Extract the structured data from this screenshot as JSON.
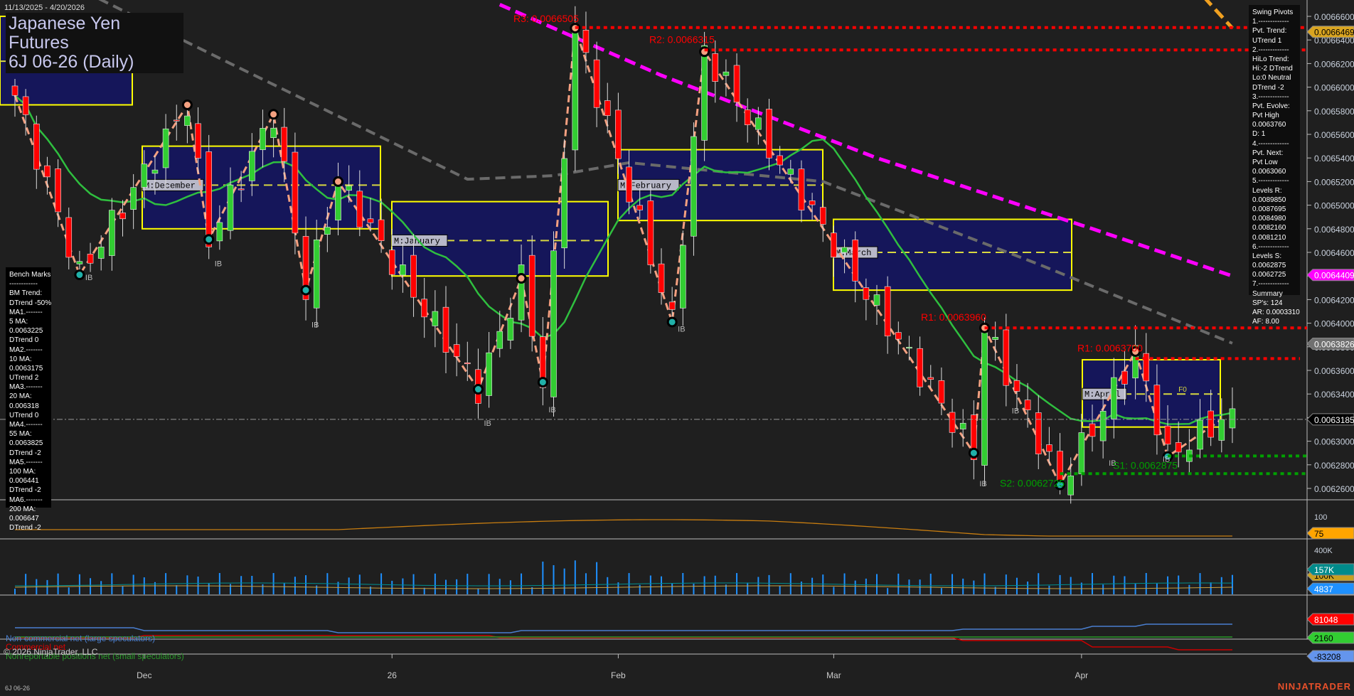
{
  "header": {
    "date_range": "11/13/2025 - 4/20/2026",
    "title_line1": "Japanese Yen Futures",
    "title_line2": "6J 06-26 (Daily)"
  },
  "swing_pivots": [
    "Swing Pivots",
    "1.-------------",
    "Pvt. Trend:",
    "UTrend 1",
    "2.-------------",
    "HiLo Trend:",
    "Hi:-2 DTrend",
    "Lo:0 Neutral",
    "DTrend -2",
    "3.-------------",
    "Pvt. Evolve:",
    "Pvt High",
    "0.0063760",
    "D: 1",
    "4.-------------",
    "Pvt. Next:",
    "Pvt Low",
    "0.0063060",
    "5.-------------",
    "Levels R:",
    "0.0089850",
    "0.0087695",
    "0.0084980",
    "0.0082160",
    "0.0081210",
    "6.-------------",
    "Levels S:",
    "0.0062875",
    "0.0062725",
    "7.-------------",
    "Summary",
    "SP's: 124",
    "AR: 0.0003310",
    "AF: 8.00"
  ],
  "bench_marks": [
    "Bench Marks",
    "------------",
    "BM Trend:",
    "DTrend -50%",
    "MA1.-------",
    "5 MA:",
    "0.0063225",
    "DTrend 0",
    "MA2.-------",
    "10 MA:",
    "0.0063175",
    "UTrend 2",
    "MA3.-------",
    "20 MA:",
    "0.006318",
    "UTrend 0",
    "MA4.-------",
    "55 MA:",
    "0.0063825",
    "DTrend -2",
    "MA5.-------",
    "100 MA:",
    "0.006441",
    "DTrend -2",
    "MA6.-------",
    "200 MA:",
    "0.006647",
    "DTrend -2"
  ],
  "price_axis": [
    "0.0066600",
    "0.0066400",
    "0.0066200",
    "0.0066000",
    "0.0065800",
    "0.0065600",
    "0.0065400",
    "0.0065200",
    "0.0065000",
    "0.0064800",
    "0.0064600",
    "0.0064400",
    "0.0064200",
    "0.0064000",
    "0.0063800",
    "0.0063600",
    "0.0063400",
    "0.0063200",
    "0.0063000",
    "0.0062800",
    "0.0062600"
  ],
  "price_tags": [
    {
      "label": "0.0066469",
      "value": 0.0066469,
      "color": "#daa520",
      "text": "#000"
    },
    {
      "label": "0.0064409",
      "value": 0.0064409,
      "color": "#ff00ff",
      "text": "#fff"
    },
    {
      "label": "0.0063826",
      "value": 0.0063826,
      "color": "#707070",
      "text": "#fff"
    },
    {
      "label": "0.0063185",
      "value": 0.0063185,
      "color": "#000000",
      "text": "#fff"
    }
  ],
  "levels": [
    {
      "label": "R3: 0.0066505",
      "value": 0.0066505,
      "from": 52,
      "color": "#ff0000"
    },
    {
      "label": "R2: 0.0066315",
      "value": 0.0066315,
      "from": 64,
      "color": "#ff0000"
    },
    {
      "label": "R1: 0.0063960",
      "value": 0.006396,
      "from": 90,
      "color": "#ff0000"
    },
    {
      "label": "R1: 0.0063700",
      "value": 0.00637,
      "from": 104,
      "color": "#ff0000"
    },
    {
      "label": "S1: 0.0062875",
      "value": 0.0062875,
      "from": 107,
      "color": "#00a000"
    },
    {
      "label": "S2: 0.0062725",
      "value": 0.0062725,
      "from": 97,
      "color": "#00a000"
    }
  ],
  "monthly_boxes": [
    {
      "label": "",
      "hi": 0.00666,
      "lo": 0.006585,
      "mid": 0.006622
    },
    {
      "label": "M:December",
      "hi": 0.00655,
      "lo": 0.00648,
      "mid": 0.006517
    },
    {
      "label": "M:January",
      "hi": 0.006503,
      "lo": 0.00644,
      "mid": 0.00647
    },
    {
      "label": "M:February",
      "hi": 0.006547,
      "lo": 0.006487,
      "mid": 0.006517
    },
    {
      "label": "M:March",
      "hi": 0.006488,
      "lo": 0.006428,
      "mid": 0.00646
    },
    {
      "label": "M:April",
      "hi": 0.006369,
      "lo": 0.006312,
      "mid": 0.00634
    }
  ],
  "x_axis": [
    {
      "label": "Dec",
      "bar": 12
    },
    {
      "label": "26",
      "bar": 35
    },
    {
      "label": "Feb",
      "bar": 56
    },
    {
      "label": "Mar",
      "bar": 76
    },
    {
      "label": "Apr",
      "bar": 99
    }
  ],
  "indicator_axis": {
    "label_100": "100",
    "tag_75": "75",
    "label_400k": "400K",
    "tag_157k": "157K",
    "tag_100k": "100K",
    "tag_4837": "4837",
    "tag_81048": "81048",
    "tag_2160": "2160",
    "tag_m83208": "-83208"
  },
  "cot_legend": {
    "noncommercial": "Non-commercial net (large speculators)",
    "commercial": "Commercial net",
    "nonreportable": "Nonreportable positions net (small speculators)"
  },
  "footer": {
    "copyright": "© 2026 NinjaTrader, LLC",
    "symbol": "6J 06-26",
    "logo": "NINJATRADER"
  },
  "ib_label": "IB",
  "fo_label": "F0",
  "chart_data": {
    "type": "candlestick",
    "price_range": [
      0.00626,
      0.00666
    ],
    "pivots": [
      [
        0,
        0.006593
      ],
      [
        6,
        0.006441
      ],
      [
        16,
        0.006585
      ],
      [
        18,
        0.006471
      ],
      [
        24,
        0.006577
      ],
      [
        27,
        0.006428
      ],
      [
        30,
        0.00652
      ],
      [
        43,
        0.006344
      ],
      [
        47,
        0.006438
      ],
      [
        49,
        0.00635
      ],
      [
        52,
        0.00665
      ],
      [
        61,
        0.006401
      ],
      [
        64,
        0.00663
      ],
      [
        89,
        0.00629
      ],
      [
        90,
        0.006396
      ],
      [
        97,
        0.006263
      ],
      [
        104,
        0.006376
      ],
      [
        107,
        0.006287
      ],
      [
        112,
        0.0063185
      ]
    ],
    "ma100_gray": [
      [
        0,
        0.00671
      ],
      [
        20,
        0.00662
      ],
      [
        42,
        0.006522
      ],
      [
        50,
        0.006525
      ],
      [
        57,
        0.006536
      ],
      [
        75,
        0.00652
      ],
      [
        95,
        0.00645
      ],
      [
        113,
        0.006383
      ]
    ],
    "ma200_magenta": [
      [
        45,
        0.00667
      ],
      [
        60,
        0.00661
      ],
      [
        80,
        0.00654
      ],
      [
        100,
        0.00648
      ],
      [
        113,
        0.00644
      ]
    ],
    "orange_trend": [
      [
        105,
        0.00673
      ],
      [
        113,
        0.00665
      ]
    ],
    "colors": {
      "up": "#32cd32",
      "down": "#ff0000",
      "ma20": "#2fbf3f",
      "box": "#15165a",
      "box_border": "#ffff00"
    }
  }
}
